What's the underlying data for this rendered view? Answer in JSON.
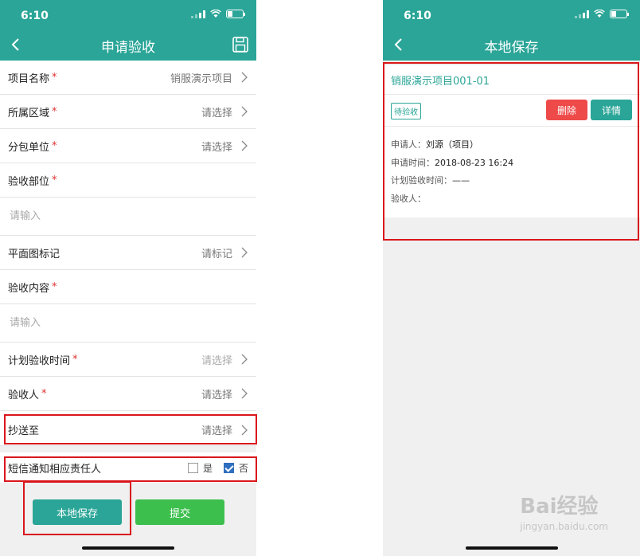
{
  "status_time": "6:10",
  "left": {
    "nav_title": "申请验收",
    "rows": [
      {
        "label": "项目名称",
        "value": "销服演示项目"
      },
      {
        "label": "所属区域",
        "value": "请选择"
      },
      {
        "label": "分包单位",
        "value": "请选择"
      },
      {
        "label": "验收部位",
        "placeholder": "请输入"
      },
      {
        "label": "平面图标记",
        "value": "请标记"
      },
      {
        "label": "验收内容",
        "placeholder": "请输入"
      },
      {
        "label": "计划验收时间",
        "value": "请选择"
      },
      {
        "label": "验收人",
        "value": "请选择"
      },
      {
        "label": "抄送至",
        "value": "请选择"
      }
    ],
    "required_mark": "*",
    "sms_label": "短信通知相应责任人",
    "sms_yes": "是",
    "sms_no": "否",
    "local_save_button": "本地保存",
    "submit_button": "提交"
  },
  "right": {
    "nav_title": "本地保存",
    "project": "销服演示项目001-01",
    "status_tag": "待验收",
    "delete_button": "删除",
    "detail_button": "详情",
    "applicant_label": "申请人：",
    "applicant": "刘源（项目）",
    "apply_time_label": "申请时间：",
    "apply_time": "2018-08-23 16:24",
    "plan_time_label": "计划验收时间：",
    "plan_time": "——",
    "inspector_label": "验收人："
  },
  "watermark": {
    "text": "Bai经验",
    "sub": "jingyan.baidu.com"
  },
  "colors": {
    "accent": "#2aa597",
    "delete": "#ee4a4a",
    "submit": "#3dbf4e",
    "highlight": "#d9161c"
  }
}
